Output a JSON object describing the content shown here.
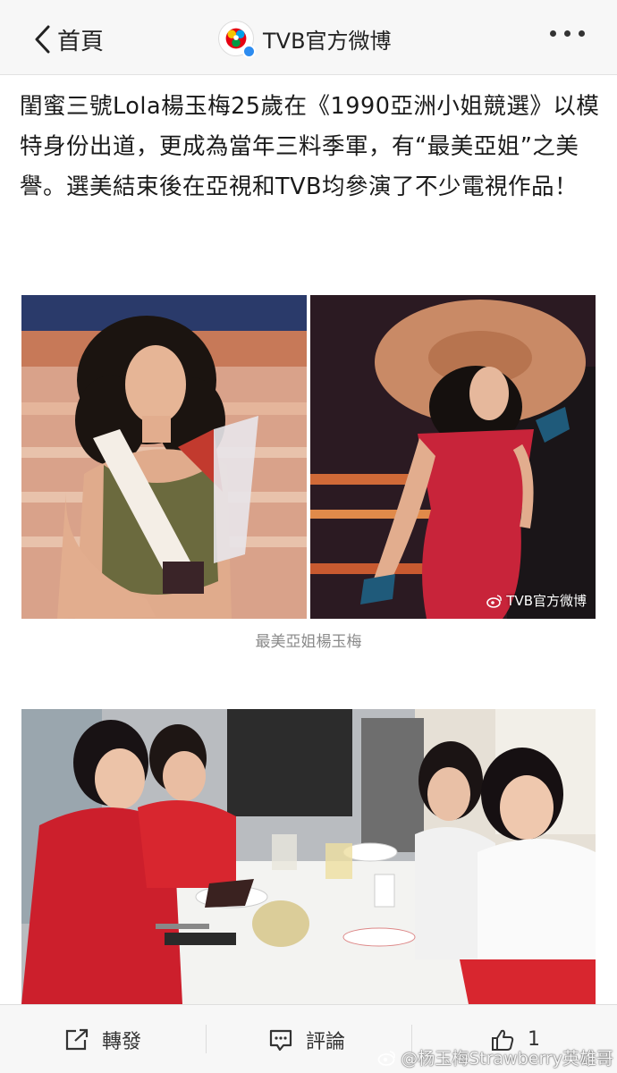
{
  "nav": {
    "back_label": "首頁",
    "account_name": "TVB官方微博"
  },
  "post": {
    "text": "閨蜜三號Lola楊玉梅25歲在《1990亞洲小姐競選》以模特身份出道，更成為當年三料季軍，有“最美亞姐”之美譽。選美結束後在亞視和TVB均參演了不少電視作品！",
    "image_watermark": "TVB官方微博",
    "caption": "最美亞姐楊玉梅"
  },
  "toolbar": {
    "repost_label": "轉發",
    "comment_label": "評論",
    "like_count": "1"
  },
  "watermark": {
    "text": "@杨玉梅Strawberry英雄哥"
  },
  "colors": {
    "nav_bg": "#f7f7f7",
    "verified_badge": "#2d8cf0",
    "caption_gray": "#8a8a8a",
    "dress_red": "#c8243a"
  }
}
